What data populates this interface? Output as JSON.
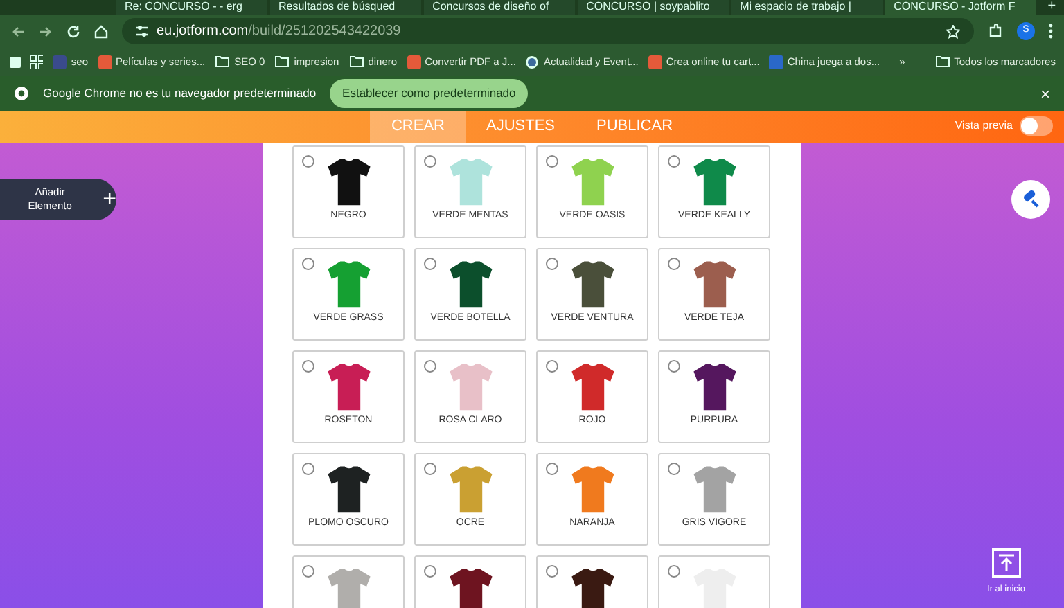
{
  "browser": {
    "tabs": [
      {
        "title": "Re: CONCURSO - - erg",
        "selected": false
      },
      {
        "title": "Resultados de búsqued",
        "selected": false
      },
      {
        "title": "Concursos de diseño of",
        "selected": false
      },
      {
        "title": "CONCURSO | soypablito",
        "selected": false
      },
      {
        "title": "Mi espacio de trabajo |",
        "selected": false
      },
      {
        "title": "CONCURSO - Jotform F",
        "selected": true
      }
    ],
    "new_tab": "+",
    "address": {
      "host": "eu.jotform.com",
      "path": "/build/251202543422039"
    },
    "profile": "S",
    "bookmarks": [
      {
        "label": "seo",
        "kind": "tp"
      },
      {
        "label": "Películas y series...",
        "kind": "site"
      },
      {
        "label": "SEO 0",
        "kind": "folder"
      },
      {
        "label": "impresion",
        "kind": "folder"
      },
      {
        "label": "dinero",
        "kind": "folder"
      },
      {
        "label": "Convertir PDF a J...",
        "kind": "site"
      },
      {
        "label": "Actualidad y Event...",
        "kind": "wp"
      },
      {
        "label": "Crea online tu cart...",
        "kind": "site"
      },
      {
        "label": "China juega a dos...",
        "kind": "lv"
      }
    ],
    "bookmarks_more": "»",
    "all_bookmarks": "Todos los marcadores",
    "infobar": {
      "message": "Google Chrome no es tu navegador predeterminado",
      "button": "Establecer como predeterminado",
      "close": "×"
    }
  },
  "builder": {
    "tabs": [
      {
        "label": "CREAR",
        "selected": true
      },
      {
        "label": "AJUSTES",
        "selected": false
      },
      {
        "label": "PUBLICAR",
        "selected": false
      }
    ],
    "preview": {
      "label": "Vista previa",
      "on": false
    },
    "add_element": {
      "label": "Añadir Elemento",
      "icon": "+"
    },
    "back_to_top": "Ir al inicio"
  },
  "options": [
    {
      "label": "NEGRO",
      "color": "#111111",
      "selected": false
    },
    {
      "label": "VERDE MENTAS",
      "color": "#aee3dc",
      "selected": false
    },
    {
      "label": "VERDE OASIS",
      "color": "#8fd24f",
      "selected": false
    },
    {
      "label": "VERDE KEALLY",
      "color": "#0f8a4a",
      "selected": false
    },
    {
      "label": "VERDE GRASS",
      "color": "#15a032",
      "selected": false
    },
    {
      "label": "VERDE BOTELLA",
      "color": "#0c4f2c",
      "selected": false
    },
    {
      "label": "VERDE VENTURA",
      "color": "#4a4f3a",
      "selected": false
    },
    {
      "label": "VERDE TEJA",
      "color": "#9c5e4e",
      "selected": false
    },
    {
      "label": "ROSETON",
      "color": "#c81e55",
      "selected": false
    },
    {
      "label": "ROSA CLARO",
      "color": "#e8c0c8",
      "selected": false
    },
    {
      "label": "ROJO",
      "color": "#d02a2a",
      "selected": false
    },
    {
      "label": "PURPURA",
      "color": "#55175e",
      "selected": false
    },
    {
      "label": "PLOMO OSCURO",
      "color": "#1e2222",
      "selected": false
    },
    {
      "label": "OCRE",
      "color": "#caa032",
      "selected": false
    },
    {
      "label": "NARANJA",
      "color": "#f07a1e",
      "selected": false
    },
    {
      "label": "GRIS VIGORE",
      "color": "#a3a3a3",
      "selected": false
    },
    {
      "color": "#b0aeab",
      "selected": false
    },
    {
      "color": "#6e1420",
      "selected": false
    },
    {
      "color": "#3a1a12",
      "selected": false
    },
    {
      "color": "#eeeeee",
      "selected": false
    }
  ]
}
